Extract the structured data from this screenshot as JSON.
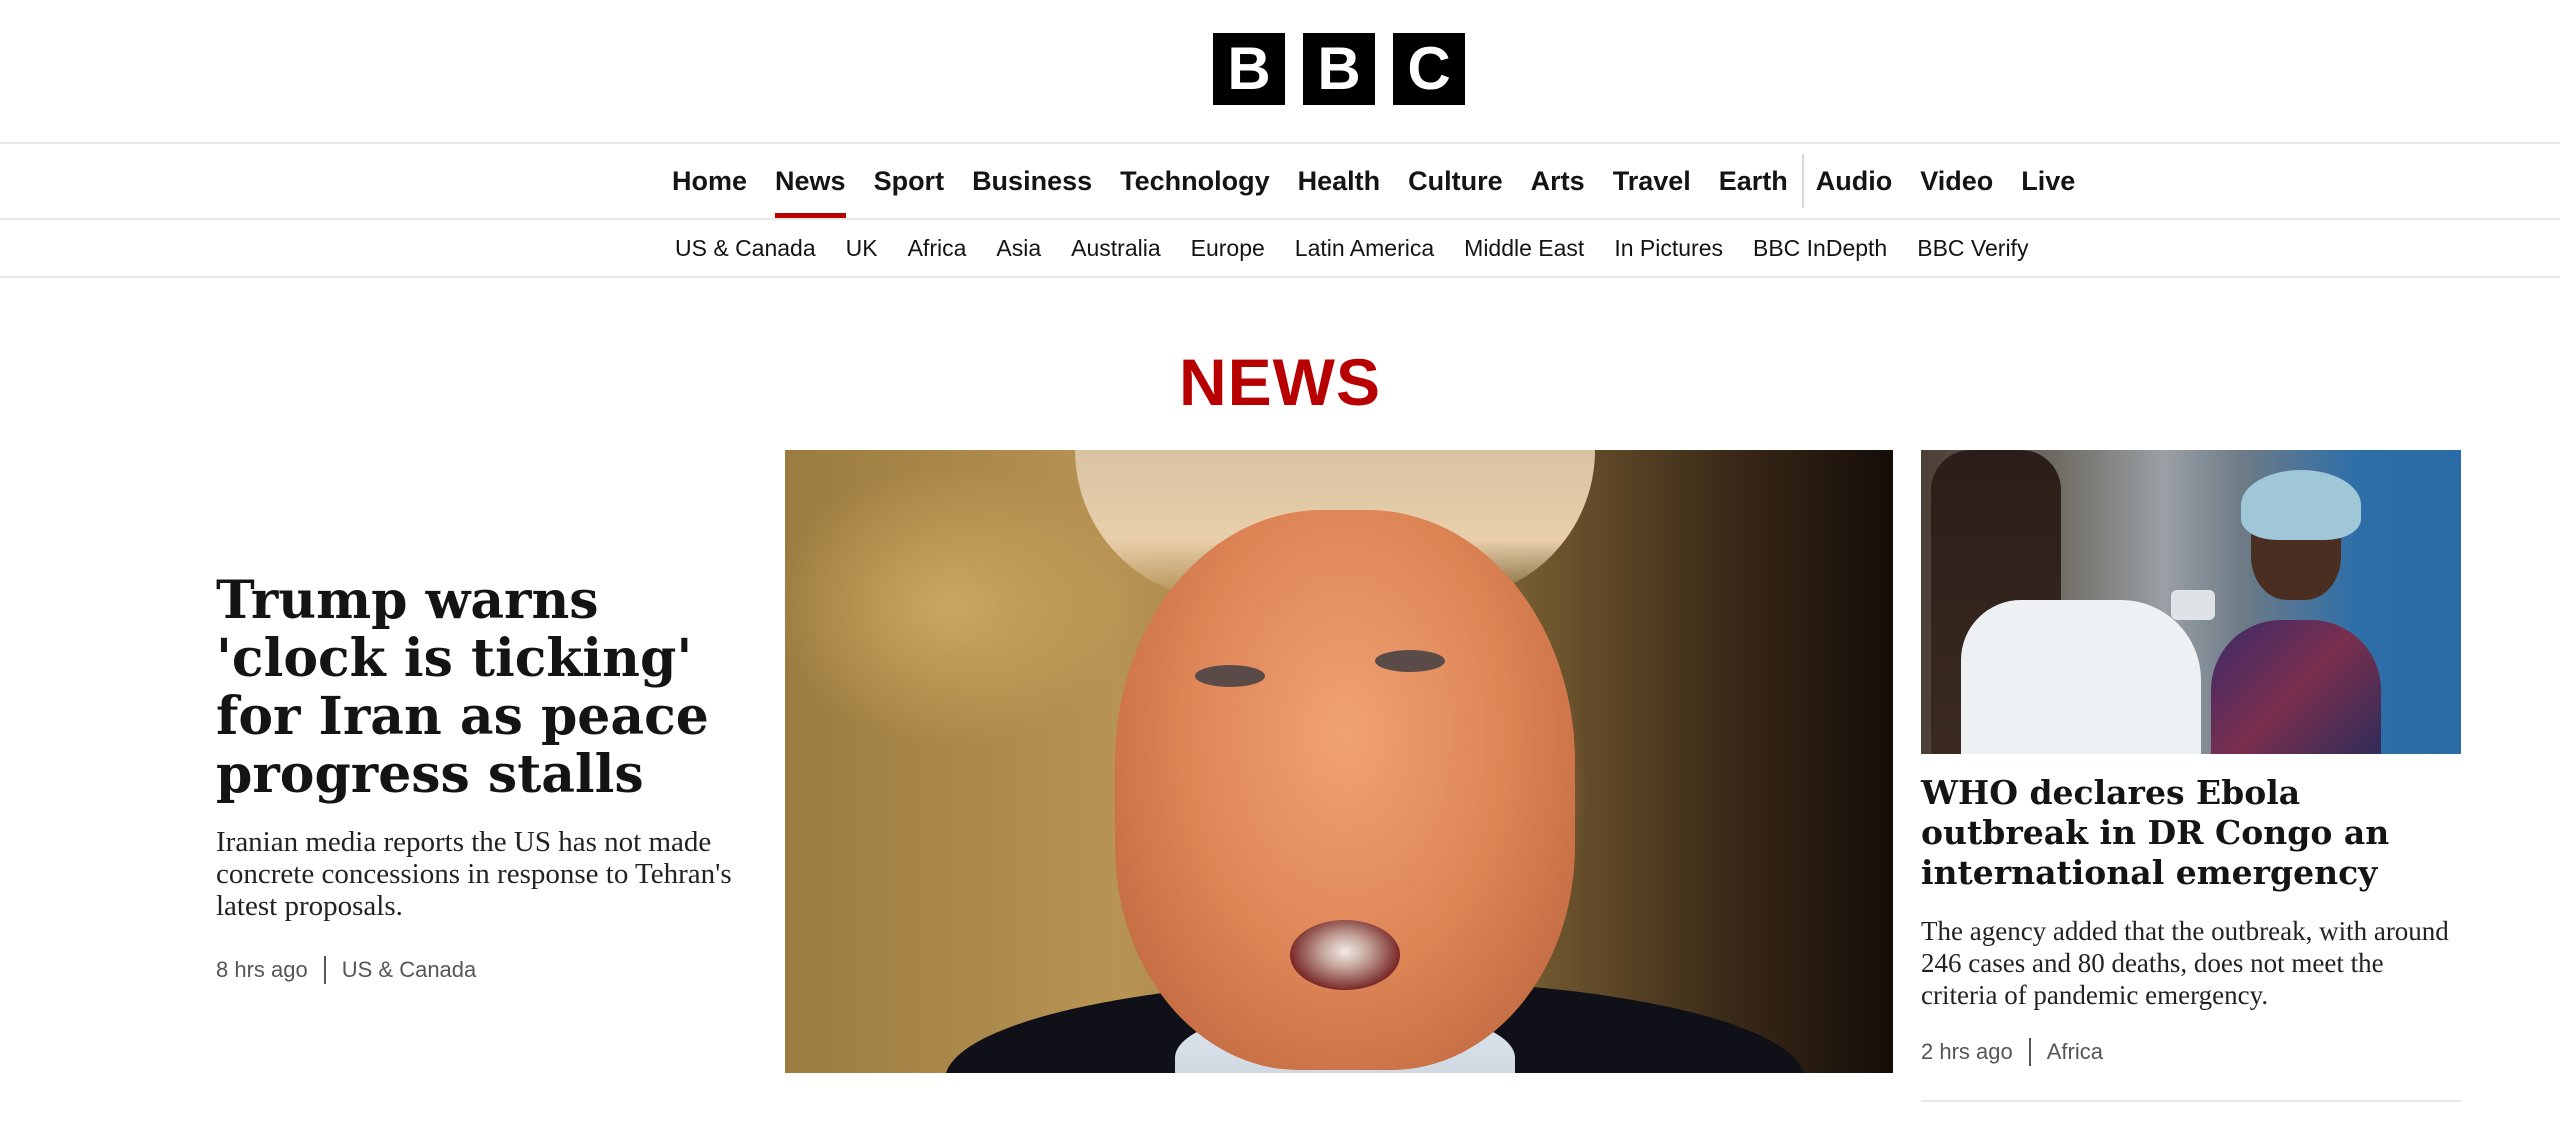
{
  "logo": {
    "letters": [
      "B",
      "B",
      "C"
    ]
  },
  "primary_nav": [
    {
      "label": "Home"
    },
    {
      "label": "News",
      "active": true
    },
    {
      "label": "Sport"
    },
    {
      "label": "Business"
    },
    {
      "label": "Technology"
    },
    {
      "label": "Health"
    },
    {
      "label": "Culture"
    },
    {
      "label": "Arts"
    },
    {
      "label": "Travel"
    },
    {
      "label": "Earth"
    },
    {
      "label": "Audio"
    },
    {
      "label": "Video"
    },
    {
      "label": "Live"
    }
  ],
  "secondary_nav": [
    {
      "label": "US & Canada"
    },
    {
      "label": "UK"
    },
    {
      "label": "Africa"
    },
    {
      "label": "Asia"
    },
    {
      "label": "Australia"
    },
    {
      "label": "Europe"
    },
    {
      "label": "Latin America"
    },
    {
      "label": "Middle East"
    },
    {
      "label": "In Pictures"
    },
    {
      "label": "BBC InDepth"
    },
    {
      "label": "BBC Verify"
    }
  ],
  "section_title": "NEWS",
  "lead_story": {
    "headline": "Trump warns 'clock is ticking' for Iran as peace progress stalls",
    "summary": "Iranian media reports the US has not made concrete concessions in response to Tehran's latest proposals.",
    "time": "8 hrs ago",
    "category": "US & Canada"
  },
  "side_story": {
    "headline": "WHO declares Ebola outbreak in DR Congo an international emergency",
    "summary": "The agency added that the outbreak, with around 246 cases and 80 deaths, does not meet the criteria of pandemic emergency.",
    "time": "2 hrs ago",
    "category": "Africa"
  },
  "colors": {
    "accent": "#b80000",
    "text": "#141414",
    "meta": "#545658"
  }
}
